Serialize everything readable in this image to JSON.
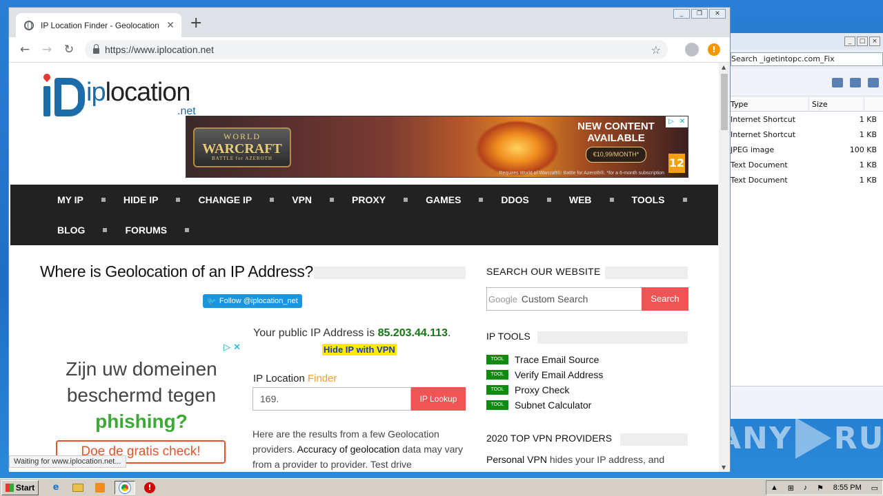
{
  "browser": {
    "tab_title": "IP Location Finder - Geolocation",
    "new_tab_symbol": "+",
    "url": "https://www.iplocation.net",
    "status_text": "Waiting for www.iplocation.net..."
  },
  "site": {
    "logo_word_prefix": "ip",
    "logo_word_suffix": "location",
    "logo_net": ".net",
    "banner": {
      "game_line1": "WORLD",
      "game_line2": "WARCRAFT",
      "game_line3": "BATTLE for AZEROTH",
      "headline_1": "NEW CONTENT",
      "headline_2": "AVAILABLE",
      "price": "€10,99/MONTH*",
      "fine_print": "Requires World of Warcraft®: Battle for Azeroth®. *for a 6-month subscription",
      "rating": "12"
    },
    "nav": {
      "row1": [
        "MY IP",
        "HIDE IP",
        "CHANGE IP",
        "VPN",
        "PROXY",
        "GAMES",
        "DDOS",
        "WEB",
        "TOOLS"
      ],
      "row2": [
        "BLOG",
        "FORUMS"
      ]
    },
    "main": {
      "heading": "Where is Geolocation of an IP Address?",
      "twitter_label": "Follow @iplocation_net",
      "public_ip_prefix": "Your public IP Address is ",
      "public_ip": "85.203.44.113",
      "public_ip_suffix": ".",
      "hide_ip_link": "Hide IP with VPN",
      "finder_label": "IP Location ",
      "finder_label_accent": "Finder",
      "finder_value": "169.",
      "finder_button": "IP Lookup",
      "results_1": "Here are the results from a few Geolocation providers. ",
      "results_2": "Accuracy of geolocation",
      "results_3": " data may vary from a provider to provider. Test drive"
    },
    "side_ad": {
      "line1": "Zijn uw domeinen",
      "line2": "beschermd tegen",
      "line3": "phishing?",
      "cta": "Doe de gratis check!"
    },
    "sidebar": {
      "search_heading": "SEARCH OUR WEBSITE",
      "google_label": "Google",
      "search_placeholder": "Custom Search",
      "search_button": "Search",
      "tools_heading": "IP TOOLS",
      "tool_badge": "TOOL",
      "tools": [
        "Trace Email Source",
        "Verify Email Address",
        "Proxy Check",
        "Subnet Calculator"
      ],
      "vpn_heading": "2020 TOP VPN PROVIDERS",
      "vpn_text_bold": "Personal VPN",
      "vpn_text_rest": " hides your IP address, and"
    }
  },
  "explorer": {
    "search_value": "Search _igetintopc.com_Fix",
    "col_type": "Type",
    "col_size": "Size",
    "rows": [
      {
        "type": "Internet Shortcut",
        "size": "1 KB"
      },
      {
        "type": "Internet Shortcut",
        "size": "1 KB"
      },
      {
        "type": "JPEG image",
        "size": "100 KB"
      },
      {
        "type": "Text Document",
        "size": "1 KB"
      },
      {
        "type": "Text Document",
        "size": "1 KB"
      }
    ]
  },
  "watermark": "ANY RUN",
  "taskbar": {
    "start_label": "Start",
    "clock": "8:55 PM"
  }
}
